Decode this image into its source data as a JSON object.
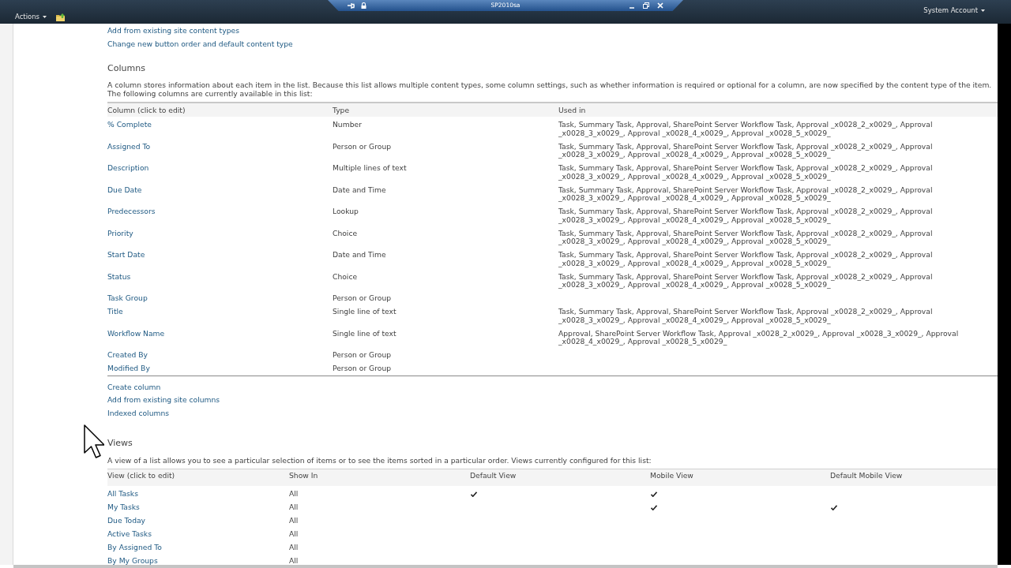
{
  "top_bar": {
    "actions_menu": "Actions",
    "account_menu": "System Account"
  },
  "remote_session_bar": {
    "title": "SP2010sa"
  },
  "content_type_links": [
    "Add from existing site content types",
    "Change new button order and default content type"
  ],
  "columns_section": {
    "heading": "Columns",
    "description": "A column stores information about each item in the list. Because this list allows multiple content types, some column settings, such as whether information is required or optional for a column, are now specified by the content type of the item. The following columns are currently available in this list:",
    "table": {
      "headers": [
        "Column (click to edit)",
        "Type",
        "Used in"
      ],
      "rows": [
        {
          "column": "% Complete",
          "type": "Number",
          "used_in": "Task, Summary Task, Approval, SharePoint Server Workflow Task, Approval _x0028_2_x0029_, Approval _x0028_3_x0029_, Approval _x0028_4_x0029_, Approval _x0028_5_x0029_"
        },
        {
          "column": "Assigned To",
          "type": "Person or Group",
          "used_in": "Task, Summary Task, Approval, SharePoint Server Workflow Task, Approval _x0028_2_x0029_, Approval _x0028_3_x0029_, Approval _x0028_4_x0029_, Approval _x0028_5_x0029_"
        },
        {
          "column": "Description",
          "type": "Multiple lines of text",
          "used_in": "Task, Summary Task, Approval, SharePoint Server Workflow Task, Approval _x0028_2_x0029_, Approval _x0028_3_x0029_, Approval _x0028_4_x0029_, Approval _x0028_5_x0029_"
        },
        {
          "column": "Due Date",
          "type": "Date and Time",
          "used_in": "Task, Summary Task, Approval, SharePoint Server Workflow Task, Approval _x0028_2_x0029_, Approval _x0028_3_x0029_, Approval _x0028_4_x0029_, Approval _x0028_5_x0029_"
        },
        {
          "column": "Predecessors",
          "type": "Lookup",
          "used_in": "Task, Summary Task, Approval, SharePoint Server Workflow Task, Approval _x0028_2_x0029_, Approval _x0028_3_x0029_, Approval _x0028_4_x0029_, Approval _x0028_5_x0029_"
        },
        {
          "column": "Priority",
          "type": "Choice",
          "used_in": "Task, Summary Task, Approval, SharePoint Server Workflow Task, Approval _x0028_2_x0029_, Approval _x0028_3_x0029_, Approval _x0028_4_x0029_, Approval _x0028_5_x0029_"
        },
        {
          "column": "Start Date",
          "type": "Date and Time",
          "used_in": "Task, Summary Task, Approval, SharePoint Server Workflow Task, Approval _x0028_2_x0029_, Approval _x0028_3_x0029_, Approval _x0028_4_x0029_, Approval _x0028_5_x0029_"
        },
        {
          "column": "Status",
          "type": "Choice",
          "used_in": "Task, Summary Task, Approval, SharePoint Server Workflow Task, Approval _x0028_2_x0029_, Approval _x0028_3_x0029_, Approval _x0028_4_x0029_, Approval _x0028_5_x0029_"
        },
        {
          "column": "Task Group",
          "type": "Person or Group"
        },
        {
          "column": "Title",
          "type": "Single line of text",
          "used_in": "Task, Summary Task, Approval, SharePoint Server Workflow Task, Approval _x0028_2_x0029_, Approval _x0028_3_x0029_, Approval _x0028_4_x0029_, Approval _x0028_5_x0029_"
        },
        {
          "column": "Workflow Name",
          "type": "Single line of text",
          "used_in": "Approval, SharePoint Server Workflow Task, Approval _x0028_2_x0029_, Approval _x0028_3_x0029_, Approval _x0028_4_x0029_, Approval _x0028_5_x0029_"
        },
        {
          "column": "Created By",
          "type": "Person or Group"
        },
        {
          "column": "Modified By",
          "type": "Person or Group"
        }
      ]
    },
    "links": [
      "Create column",
      "Add from existing site columns",
      "Indexed columns"
    ]
  },
  "views_section": {
    "heading": "Views",
    "description": "A view of a list allows you to see a particular selection of items or to see the items sorted in a particular order. Views currently configured for this list:",
    "table": {
      "headers": [
        "View (click to edit)",
        "Show In",
        "Default View",
        "Mobile View",
        "Default Mobile View"
      ],
      "rows": [
        {
          "view": "All Tasks",
          "show_in": "All",
          "default_view": true,
          "mobile_view": true,
          "default_mobile_view": false
        },
        {
          "view": "My Tasks",
          "show_in": "All",
          "default_view": false,
          "mobile_view": true,
          "default_mobile_view": true
        },
        {
          "view": "Due Today",
          "show_in": "All",
          "default_view": false,
          "mobile_view": false,
          "default_mobile_view": false
        },
        {
          "view": "Active Tasks",
          "show_in": "All",
          "default_view": false,
          "mobile_view": false,
          "default_mobile_view": false
        },
        {
          "view": "By Assigned To",
          "show_in": "All",
          "default_view": false,
          "mobile_view": false,
          "default_mobile_view": false
        },
        {
          "view": "By My Groups",
          "show_in": "All",
          "default_view": false,
          "mobile_view": false,
          "default_mobile_view": false
        }
      ]
    }
  }
}
